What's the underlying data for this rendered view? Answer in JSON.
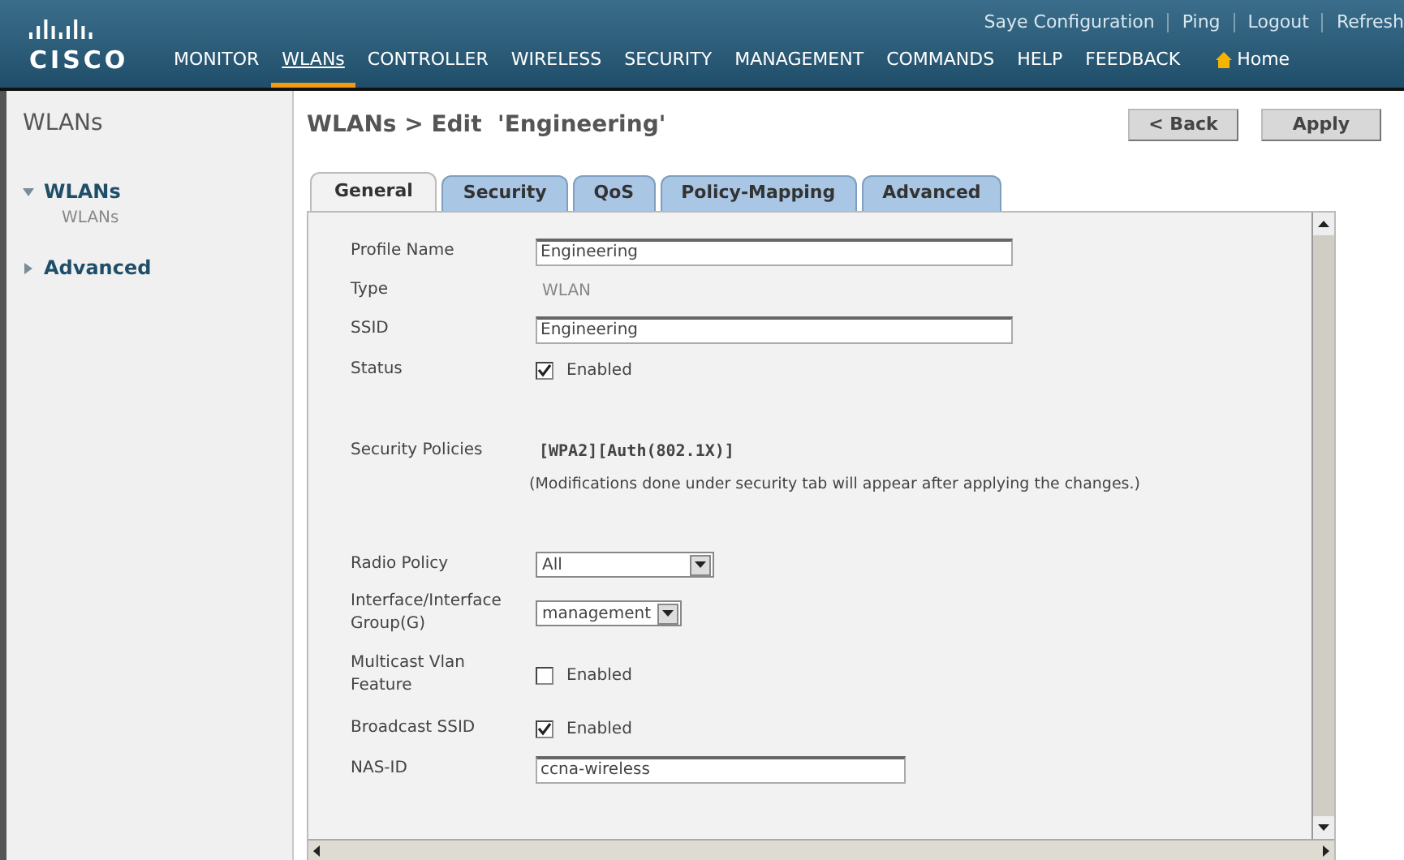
{
  "header": {
    "logo": "CISCO",
    "top_links": [
      "Saye Configuration",
      "Ping",
      "Logout",
      "Refresh"
    ],
    "nav": [
      {
        "label": "MONITOR",
        "selected": false
      },
      {
        "label": "WLANs",
        "selected": true
      },
      {
        "label": "CONTROLLER",
        "selected": false
      },
      {
        "label": "WIRELESS",
        "selected": false
      },
      {
        "label": "SECURITY",
        "selected": false
      },
      {
        "label": "MANAGEMENT",
        "selected": false
      },
      {
        "label": "COMMANDS",
        "selected": false
      },
      {
        "label": "HELP",
        "selected": false
      },
      {
        "label": "FEEDBACK",
        "selected": false
      },
      {
        "label": "Home",
        "selected": false
      }
    ]
  },
  "sidebar": {
    "title": "WLANs",
    "items": [
      {
        "label": "WLANs",
        "expanded": true,
        "children": [
          {
            "label": "WLANs"
          }
        ]
      },
      {
        "label": "Advanced",
        "expanded": false
      }
    ]
  },
  "page": {
    "title": "WLANs > Edit  'Engineering'",
    "buttons": [
      "< Back",
      "Apply"
    ],
    "tabs": [
      {
        "label": "General",
        "selected": true
      },
      {
        "label": "Security",
        "selected": false
      },
      {
        "label": "QoS",
        "selected": false
      },
      {
        "label": "Policy-Mapping",
        "selected": false
      },
      {
        "label": "Advanced",
        "selected": false
      }
    ],
    "fields": [
      {
        "kind": "input",
        "label": "Profile Name",
        "value": "Engineering"
      },
      {
        "kind": "text",
        "label": "Type",
        "value": "WLAN"
      },
      {
        "kind": "input",
        "label": "SSID",
        "value": "Engineering"
      },
      {
        "kind": "checkbox",
        "label": "Status",
        "value": "Enabled",
        "checked": true
      },
      {
        "kind": "policy",
        "label": "Security Policies",
        "value": "[WPA2][Auth(802.1X)]",
        "note": "(Modifications done under security tab will appear after applying the changes.)"
      },
      {
        "kind": "select",
        "label": "Radio Policy",
        "value": "All"
      },
      {
        "kind": "select",
        "label": "Interface/Interface Group(G)",
        "value": "management"
      },
      {
        "kind": "checkbox",
        "label": "Multicast Vlan Feature",
        "value": "Enabled",
        "checked": false
      },
      {
        "kind": "checkbox",
        "label": "Broadcast SSID",
        "value": "Enabled",
        "checked": true
      },
      {
        "kind": "input",
        "label": "NAS-ID",
        "value": "ccna-wireless"
      }
    ]
  }
}
